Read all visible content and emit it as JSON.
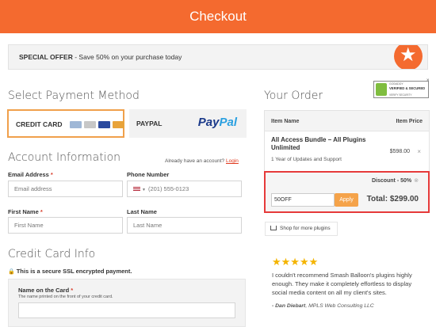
{
  "header": {
    "title": "Checkout"
  },
  "offer": {
    "title": "SPECIAL OFFER",
    "text": " - Save 50% on your purchase today",
    "icon": "star-icon"
  },
  "payment": {
    "heading": "Select Payment Method",
    "credit_card_label": "CREDIT CARD",
    "paypal_label": "PAYPAL",
    "paypal_logo_a": "Pay",
    "paypal_logo_b": "Pal"
  },
  "account": {
    "heading": "Account Information",
    "login_prompt": "Already have an account?",
    "login_link": "Login",
    "email_label": "Email Address",
    "email_placeholder": "Email address",
    "phone_label": "Phone Number",
    "phone_placeholder": "(201) 555-0123",
    "first_label": "First Name",
    "first_placeholder": "First Name",
    "last_label": "Last Name",
    "last_placeholder": "Last Name",
    "required_mark": "*"
  },
  "credit_card_info": {
    "heading": "Credit Card Info",
    "ssl_text": "This is a secure SSL encrypted payment.",
    "name_label": "Name on the Card",
    "name_help": "The name printed on the front of your credit card."
  },
  "order": {
    "heading": "Your Order",
    "col_name": "Item Name",
    "col_price": "Item Price",
    "item_name": "All Access Bundle – All Plugins Unlimited",
    "item_sub": "1 Year of Updates and Support",
    "item_price": "$598.00",
    "remove": "×",
    "discount_label": "Discount - 50%",
    "discount_remove": "⊗",
    "coupon_value": "50OFF",
    "apply_label": "Apply",
    "total_label": "Total: $299.00",
    "shop_more": "Shop for more plugins"
  },
  "badge": {
    "line1": "GODADDY",
    "line2": "VERIFIED & SECURED",
    "line3": "VERIFY SECURITY",
    "close": "×"
  },
  "testimonial": {
    "stars": "★★★★★",
    "quote": "I couldn't recommend Smash Balloon's plugins highly enough. They make it completely effortless to display social media content on all my client's sites.",
    "author_name": "- Dan Diebart",
    "author_org": ", MPLS Web Consulting LLC"
  },
  "colors": {
    "brand": "#f46a2f",
    "highlight": "#e63a3a",
    "apply": "#f5a34a"
  }
}
